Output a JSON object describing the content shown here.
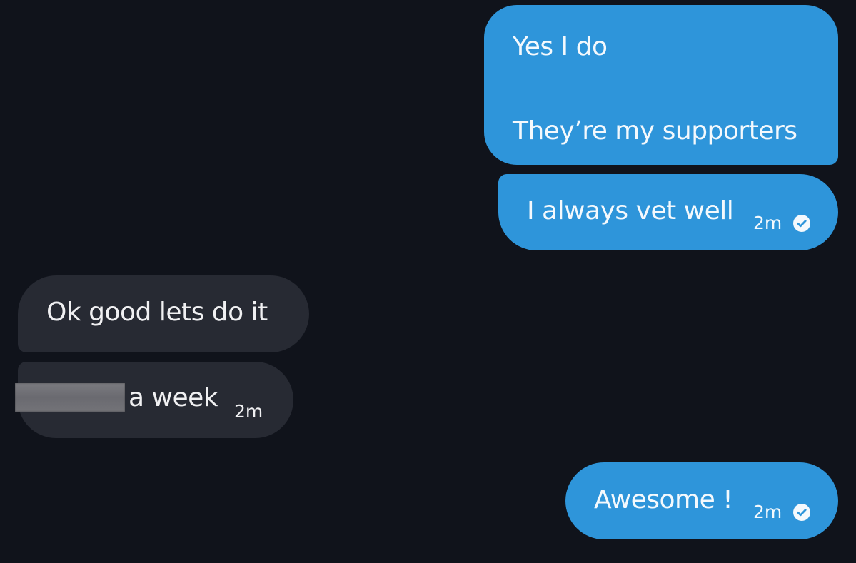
{
  "colors": {
    "background": "#10131b",
    "sent_bubble": "#2e95da",
    "received_bubble": "#272a33",
    "text": "#ffffff"
  },
  "messages": [
    {
      "direction": "sent",
      "lines": [
        "Yes I do",
        "They’re my supporters"
      ]
    },
    {
      "direction": "sent",
      "text": "I always vet well",
      "time": "2m",
      "status_icon": "check-circle-icon"
    },
    {
      "direction": "received",
      "text": "Ok good lets do it"
    },
    {
      "direction": "received",
      "text": "a week",
      "time": "2m",
      "redacted": true
    },
    {
      "direction": "sent",
      "text": "Awesome !",
      "time": "2m",
      "status_icon": "check-circle-icon"
    }
  ]
}
